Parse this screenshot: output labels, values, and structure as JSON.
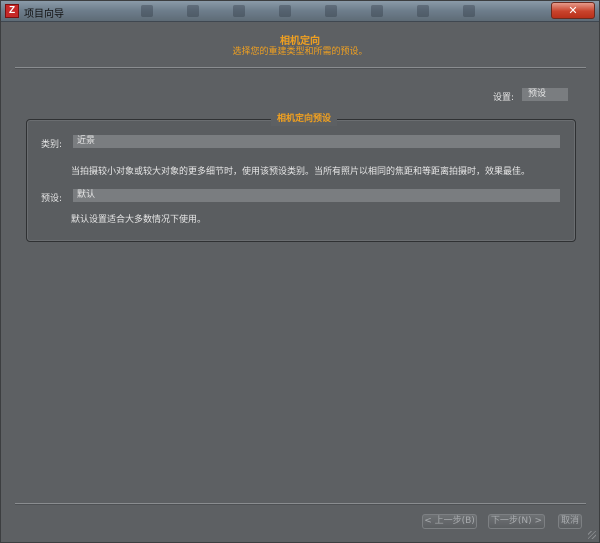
{
  "window": {
    "title": "项目向导",
    "app_icon": "Z",
    "close_label": "✕"
  },
  "header": {
    "title": "相机定向",
    "subtitle": "选择您的重建类型和所需的预设。"
  },
  "settings": {
    "label": "设置:",
    "value": "预设"
  },
  "group": {
    "title": "相机定向预设",
    "category_label": "类别:",
    "category_value": "近景",
    "category_desc": "当拍摄较小对象或较大对象的更多细节时，使用该预设类别。当所有照片以相同的焦距和等距离拍摄时，效果最佳。",
    "preset_label": "预设:",
    "preset_value": "默认",
    "preset_desc": "默认设置适合大多数情况下使用。"
  },
  "footer": {
    "back_label": "< 上一步(B)",
    "next_label": "下一步(N) >",
    "cancel_label": "取消"
  },
  "colors": {
    "accent": "#f0a020",
    "background": "#5d6063",
    "field": "#7a7d80"
  }
}
